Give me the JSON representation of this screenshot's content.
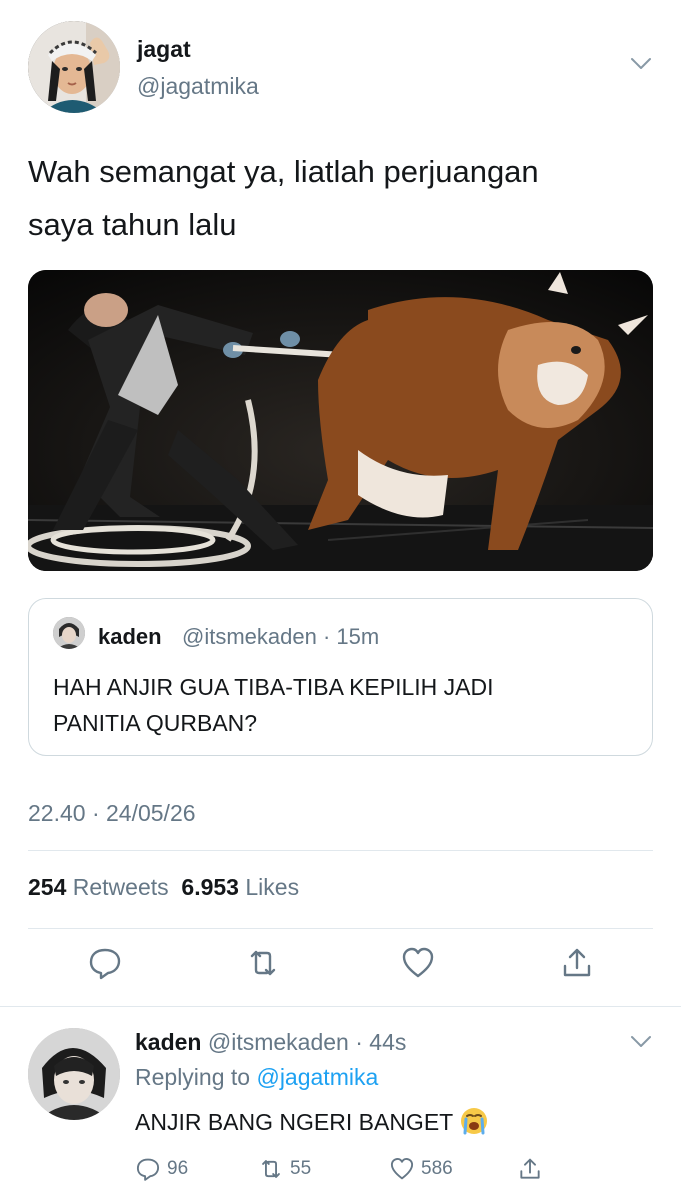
{
  "tweet": {
    "author_name": "jagat",
    "author_handle": "@jagatmika",
    "text_line1": "Wah semangat ya, liatlah perjuangan",
    "text_line2": "saya tahun lalu",
    "timestamp": "22.40 · 24/05/26",
    "retweet_count": "254",
    "retweets_label": "Retweets",
    "like_count": "6.953",
    "likes_label": "Likes"
  },
  "quote": {
    "author_name": "kaden",
    "author_handle": "@itsmekaden · 15m",
    "text_line1": "HAH ANJIR GUA TIBA-TIBA KEPILIH JADI",
    "text_line2": "PANITIA QURBAN?"
  },
  "reply": {
    "author_name": "kaden",
    "author_handle": "@itsmekaden · 44s",
    "replying_prefix": "Replying to",
    "replying_to": "@jagatmika",
    "text": "ANJIR BANG NGERI BANGET",
    "reply_count": "96",
    "retweet_count": "55",
    "like_count": "586"
  },
  "icons": {
    "chevron": "chevron-down-icon",
    "reply": "reply-icon",
    "retweet": "retweet-icon",
    "like": "heart-icon",
    "share": "share-icon",
    "emoji": "loudly-crying-face-emoji"
  },
  "colors": {
    "text": "#14171a",
    "secondary": "#657786",
    "link": "#1da1f2",
    "divider": "#e1e8ed"
  }
}
